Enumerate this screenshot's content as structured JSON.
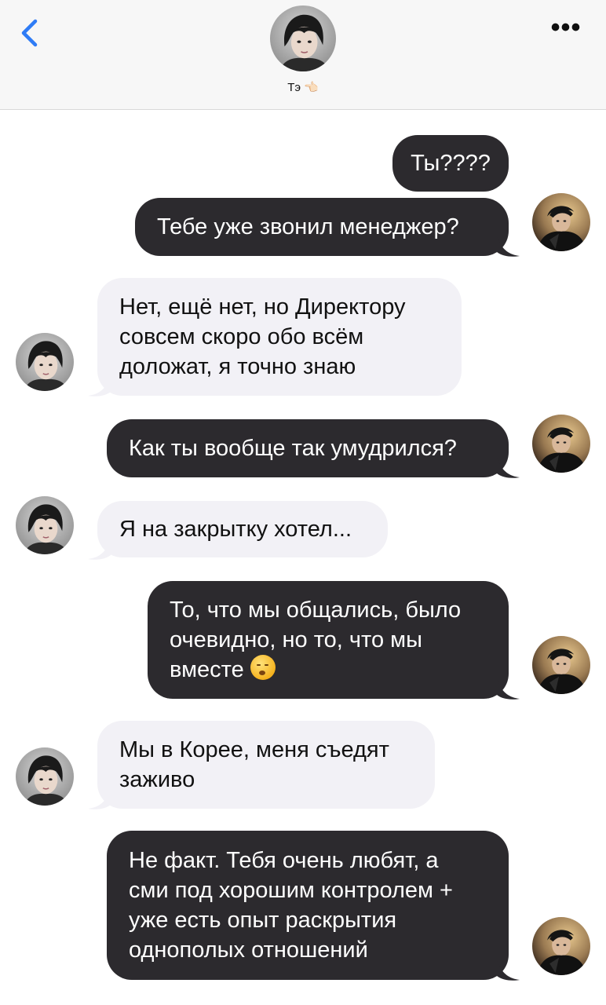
{
  "header": {
    "contact_name": "Тэ",
    "contact_emoji": "👈🏻",
    "back_icon": "chevron-left-icon",
    "more_icon": "ellipsis-icon",
    "more_label": "•••"
  },
  "colors": {
    "outgoing_bubble": "#2c2a2e",
    "incoming_bubble": "#f2f1f6",
    "accent": "#2f7cf6"
  },
  "messages": [
    {
      "direction": "outgoing",
      "text": "Ты????"
    },
    {
      "direction": "outgoing",
      "text": "Тебе уже звонил менеджер?"
    },
    {
      "direction": "incoming",
      "lines": [
        "Нет, ещё нет, но Директору",
        "совсем скоро обо всём",
        "доложат, я точно знаю"
      ]
    },
    {
      "direction": "outgoing",
      "text": "Как ты вообще так умудрился?"
    },
    {
      "direction": "incoming",
      "text": "Я на закрытку хотел..."
    },
    {
      "direction": "outgoing",
      "lines": [
        "То, что мы общались, было",
        "очевидно, но то, что мы",
        "вместе"
      ],
      "emoji": "tired-face-emoji"
    },
    {
      "direction": "incoming",
      "lines": [
        "Мы в Корее, меня съедят",
        "заживо"
      ]
    },
    {
      "direction": "outgoing",
      "lines": [
        "Не факт. Тебя очень любят, а",
        "сми под хорошим контролем +",
        "уже есть опыт раскрытия",
        "однополых отношений"
      ]
    }
  ]
}
